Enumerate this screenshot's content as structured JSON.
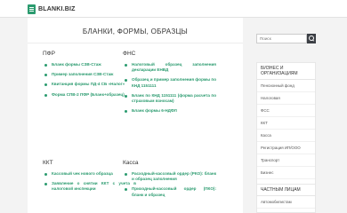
{
  "site": {
    "logo_text": "BLANKI.BIZ"
  },
  "page": {
    "title": "БЛАНКИ, ФОРМЫ, ОБРАЗЦЫ"
  },
  "sections": [
    {
      "title": "ПФР",
      "links": [
        "Бланк формы СЗВ-Стаж",
        "Пример заполнения СЗВ-Стаж",
        "Квитанция формы ПД-4 СБ «Налог»",
        "Форма СПВ-2 ПФР (Бланк+образец)"
      ]
    },
    {
      "title": "ФНС",
      "links": [
        "Налоговый образец заполнения декларации ЕНВД",
        "Образец и пример заполнения формы по КНД 1151111",
        "Бланк по КНД 1151111 (форма расчета по страховым взносам)",
        "Бланк формы 6-НДФЛ"
      ]
    },
    {
      "title": "ККТ",
      "links": [
        "Кассовый чек нового образца",
        "Заявление о снятии ККТ с учета в налоговой инспекции"
      ]
    },
    {
      "title": "Касса",
      "links": [
        "Расходный-кассовый ордер (РКО): бланк и образец заполнения",
        "Приходный-кассовый ордер (ПКО): бланк и образец"
      ]
    }
  ],
  "sidebar": {
    "search_placeholder": "Поиск",
    "business": {
      "title": "БИЗНЕС И ОРГАНИЗАЦИЯМ",
      "items": [
        "Пенсионный фонд",
        "Налоговая",
        "ФСС",
        "ККТ",
        "Касса",
        "Регистрация ИП/ООО",
        "Транспорт",
        "Бизнес"
      ]
    },
    "people": {
      "title": "ЧАСТНЫМ ЛИЦАМ",
      "items": [
        "Автомобилистам"
      ]
    }
  },
  "colors": {
    "accent": "#2b9b6f",
    "search_button": "#3c3f45"
  }
}
